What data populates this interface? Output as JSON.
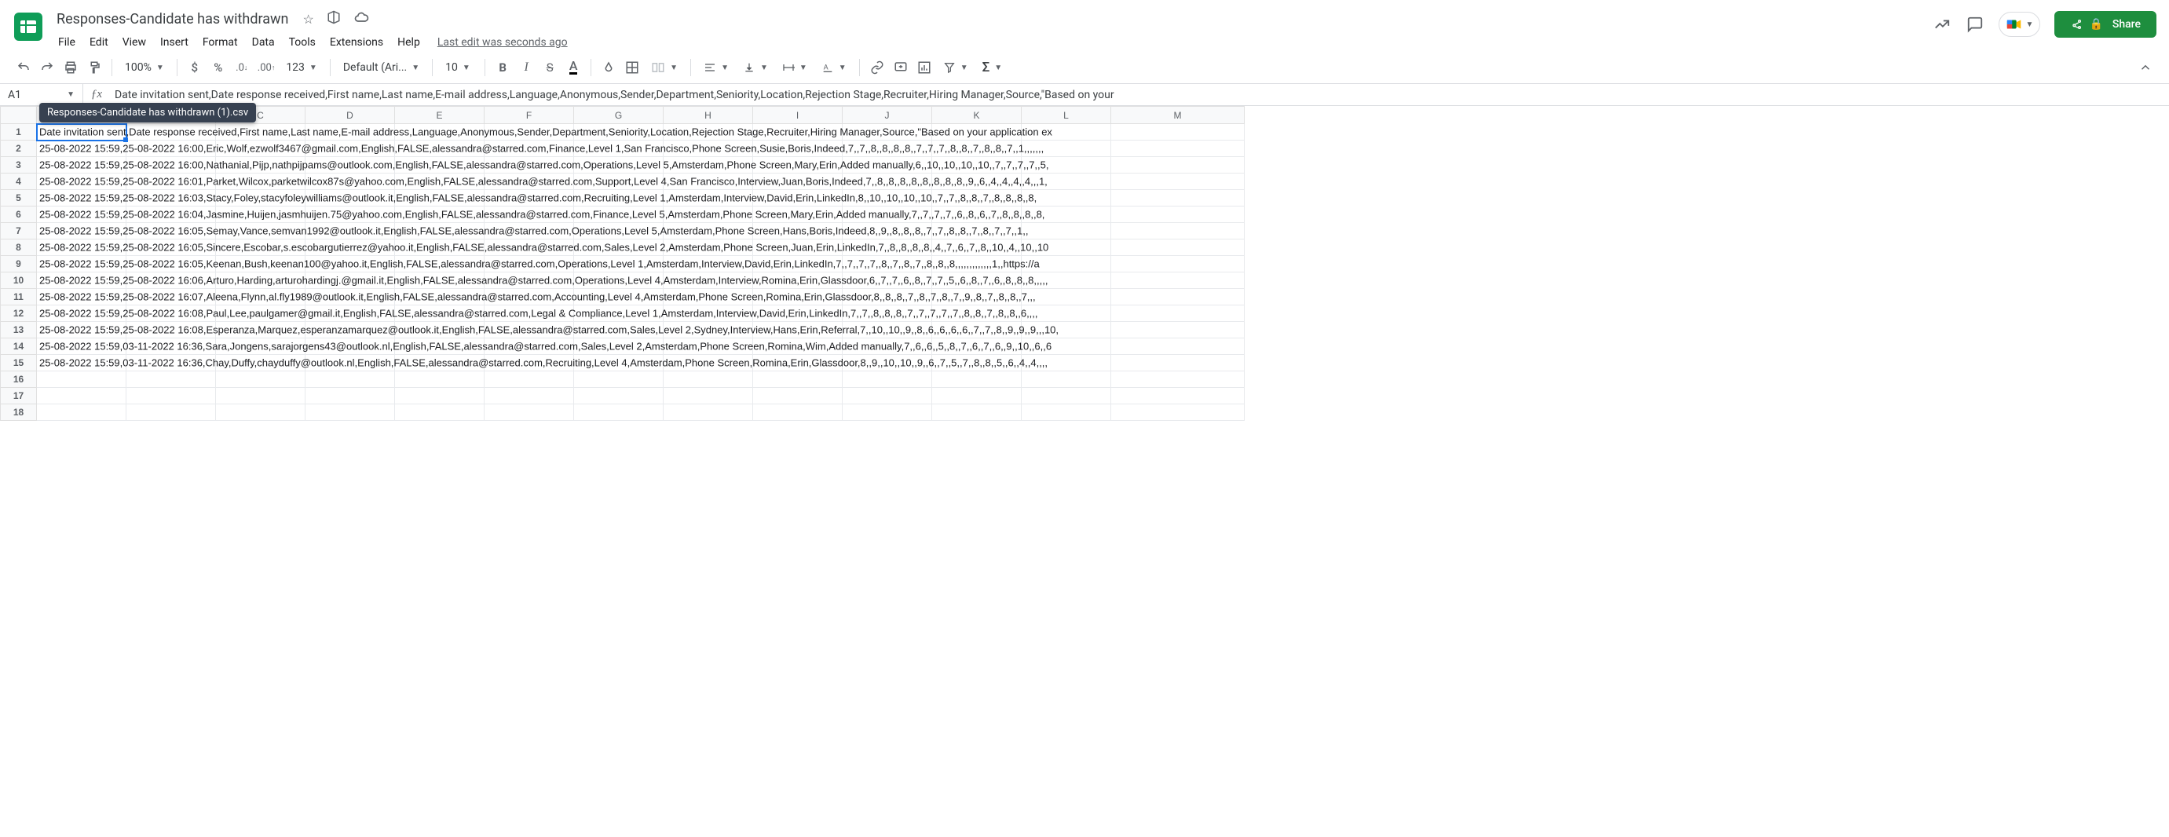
{
  "doc": {
    "title": "Responses-Candidate has withdrawn",
    "tooltip": "Responses-Candidate has withdrawn (1).csv",
    "last_edit": "Last edit was seconds ago"
  },
  "menus": [
    "File",
    "Edit",
    "View",
    "Insert",
    "Format",
    "Data",
    "Tools",
    "Extensions",
    "Help"
  ],
  "share": {
    "label": "Share"
  },
  "toolbar": {
    "zoom": "100%",
    "font": "Default (Ari...",
    "font_size": "10",
    "number_format": "123"
  },
  "namebox": "A1",
  "formula_bar": "Date invitation sent,Date response received,First name,Last name,E-mail address,Language,Anonymous,Sender,Department,Seniority,Location,Rejection Stage,Recruiter,Hiring Manager,Source,\"Based on your",
  "columns": [
    "A",
    "B",
    "C",
    "D",
    "E",
    "F",
    "G",
    "H",
    "I",
    "J",
    "K",
    "L",
    "M"
  ],
  "row_count": 18,
  "rows": [
    "Date invitation sent,Date response received,First name,Last name,E-mail address,Language,Anonymous,Sender,Department,Seniority,Location,Rejection Stage,Recruiter,Hiring Manager,Source,\"Based on your application ex",
    "25-08-2022 15:59,25-08-2022 16:00,Eric,Wolf,ezwolf3467@gmail.com,English,FALSE,alessandra@starred.com,Finance,Level 1,San Francisco,Phone Screen,Susie,Boris,Indeed,7,,7,,8,,8,,8,,8,,7,,7,,7,,8,,8,,7,,8,,8,,7,,1,,,,,,,",
    "25-08-2022 15:59,25-08-2022 16:00,Nathanial,Pijp,nathpijpams@outlook.com,English,FALSE,alessandra@starred.com,Operations,Level 5,Amsterdam,Phone Screen,Mary,Erin,Added manually,6,,10,,10,,10,,10,,7,,7,,7,,7,,5,",
    "25-08-2022 15:59,25-08-2022 16:01,Parket,Wilcox,parketwilcox87s@yahoo.com,English,FALSE,alessandra@starred.com,Support,Level 4,San Francisco,Interview,Juan,Boris,Indeed,7,,8,,8,,8,,8,,8,,8,,8,,8,,9,,6,,4,,4,,4,,4,,,1,",
    "25-08-2022 15:59,25-08-2022 16:03,Stacy,Foley,stacyfoleywilliams@outlook.it,English,FALSE,alessandra@starred.com,Recruiting,Level 1,Amsterdam,Interview,David,Erin,LinkedIn,8,,10,,10,,10,,10,,7,,7,,8,,8,,7,,8,,8,,8,,8,",
    "25-08-2022 15:59,25-08-2022 16:04,Jasmine,Huijen,jasmhuijen.75@yahoo.com,English,FALSE,alessandra@starred.com,Finance,Level 5,Amsterdam,Phone Screen,Mary,Erin,Added manually,7,,7,,7,,7,,6,,8,,6,,7,,8,,8,,8,,8,",
    "25-08-2022 15:59,25-08-2022 16:05,Semay,Vance,semvan1992@outlook.it,English,FALSE,alessandra@starred.com,Operations,Level 5,Amsterdam,Phone Screen,Hans,Boris,Indeed,8,,9,,8,,8,,8,,7,,7,,8,,8,,7,,8,,7,,7,,1,,",
    "25-08-2022 15:59,25-08-2022 16:05,Sincere,Escobar,s.escobargutierrez@yahoo.it,English,FALSE,alessandra@starred.com,Sales,Level 2,Amsterdam,Phone Screen,Juan,Erin,LinkedIn,7,,8,,8,,8,,8,,4,,7,,6,,7,,8,,10,,4,,10,,10",
    "25-08-2022 15:59,25-08-2022 16:05,Keenan,Bush,keenan100@yahoo.it,English,FALSE,alessandra@starred.com,Operations,Level 1,Amsterdam,Interview,David,Erin,LinkedIn,7,,7,,7,,7,,8,,7,,8,,7,,8,,8,,8,,,,,,,,,,,,,1,,https://a",
    "25-08-2022 15:59,25-08-2022 16:06,Arturo,Harding,arturohardingj.@gmail.it,English,FALSE,alessandra@starred.com,Operations,Level 4,Amsterdam,Interview,Romina,Erin,Glassdoor,6,,7,,7,,6,,8,,7,,7,,5,,6,,8,,7,,6,,8,,8,,8,,,,,",
    "25-08-2022 15:59,25-08-2022 16:07,Aleena,Flynn,al.fly1989@outlook.it,English,FALSE,alessandra@starred.com,Accounting,Level 4,Amsterdam,Phone Screen,Romina,Erin,Glassdoor,8,,8,,8,,7,,8,,7,,8,,7,,9,,8,,7,,8,,8,,7,,,",
    "25-08-2022 15:59,25-08-2022 16:08,Paul,Lee,paulgamer@gmail.it,English,FALSE,alessandra@starred.com,Legal & Compliance,Level 1,Amsterdam,Interview,David,Erin,LinkedIn,7,,7,,8,,8,,8,,7,,7,,7,,7,,7,,8,,8,,7,,8,,8,,6,,,,",
    "25-08-2022 15:59,25-08-2022 16:08,Esperanza,Marquez,esperanzamarquez@outlook.it,English,FALSE,alessandra@starred.com,Sales,Level 2,Sydney,Interview,Hans,Erin,Referral,7,,10,,10,,9,,8,,6,,6,,6,,6,,7,,7,,8,,9,,9,,9,,,10,",
    "25-08-2022 15:59,03-11-2022 16:36,Sara,Jongens,sarajorgens43@outlook.nl,English,FALSE,alessandra@starred.com,Sales,Level 2,Amsterdam,Phone Screen,Romina,Wim,Added manually,7,,6,,6,,5,,8,,7,,6,,7,,6,,9,,10,,6,,6",
    "25-08-2022 15:59,03-11-2022 16:36,Chay,Duffy,chayduffy@outlook.nl,English,FALSE,alessandra@starred.com,Recruiting,Level 4,Amsterdam,Phone Screen,Romina,Erin,Glassdoor,8,,9,,10,,10,,9,,6,,7,,5,,7,,8,,8,,5,,6,,4,,4,,,,"
  ]
}
